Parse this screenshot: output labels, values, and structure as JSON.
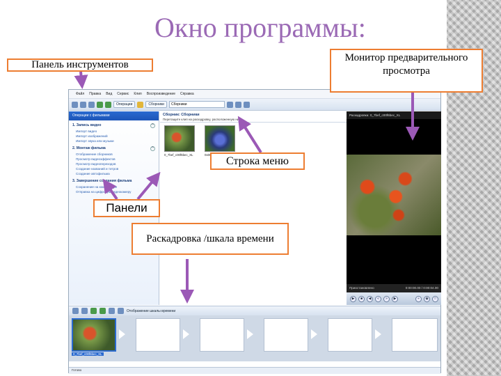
{
  "slide": {
    "title": "Окно программы:",
    "accent_color": "#9b6ab5",
    "callout_border_color": "#ed7d31",
    "arrow_color": "#9b59b6"
  },
  "callouts": {
    "toolbar": "Панель инструментов",
    "monitor": "Монитор предварительного просмотра",
    "menu": "Строка меню",
    "panels": "Панели",
    "storyboard": "Раскадровка /шкала времени"
  },
  "app": {
    "menu": [
      "Файл",
      "Правка",
      "Вид",
      "Сервис",
      "Клип",
      "Воспроизведение",
      "Справка"
    ],
    "toolbar": {
      "operations_button": "Операции",
      "collections_button": "Сборники",
      "collections_select": "Сборники"
    },
    "task_pane": {
      "header": "Операции с фильмами",
      "sections": [
        {
          "title": "1. Запись видео",
          "links": [
            "Импорт видео",
            "Импорт изображений",
            "Импорт звука или музыки"
          ]
        },
        {
          "title": "2. Монтаж фильма",
          "links": [
            "Отображение сборников",
            "Просмотр видеоэффектов",
            "Просмотр видеопереходов",
            "Создание названий и титров",
            "Создание автофильма"
          ]
        },
        {
          "title": "3. Завершение создания фильма",
          "links": [
            "Сохранение на компьютере",
            "Отправка на цифровую видеокамеру"
          ]
        }
      ]
    },
    "collection": {
      "title": "Сборник: Сборники",
      "hint": "Перетащите клип на раскадровку, расположенную ниже.",
      "clips": [
        "0_7bef_c00f6bec_XL",
        "0x06..."
      ]
    },
    "monitor": {
      "header": "Раскадровка: 0_7bef_c00f6bec_XL",
      "status": "Приостановлено",
      "time": "0:00:00.00 / 0:00:04.00"
    },
    "storyboard": {
      "toolbar_label": "Отображение шкалы времени",
      "first_clip_label": "0_7bef_c00f6bec_XL",
      "frame_count": 7
    },
    "status_bar": "Готово"
  }
}
